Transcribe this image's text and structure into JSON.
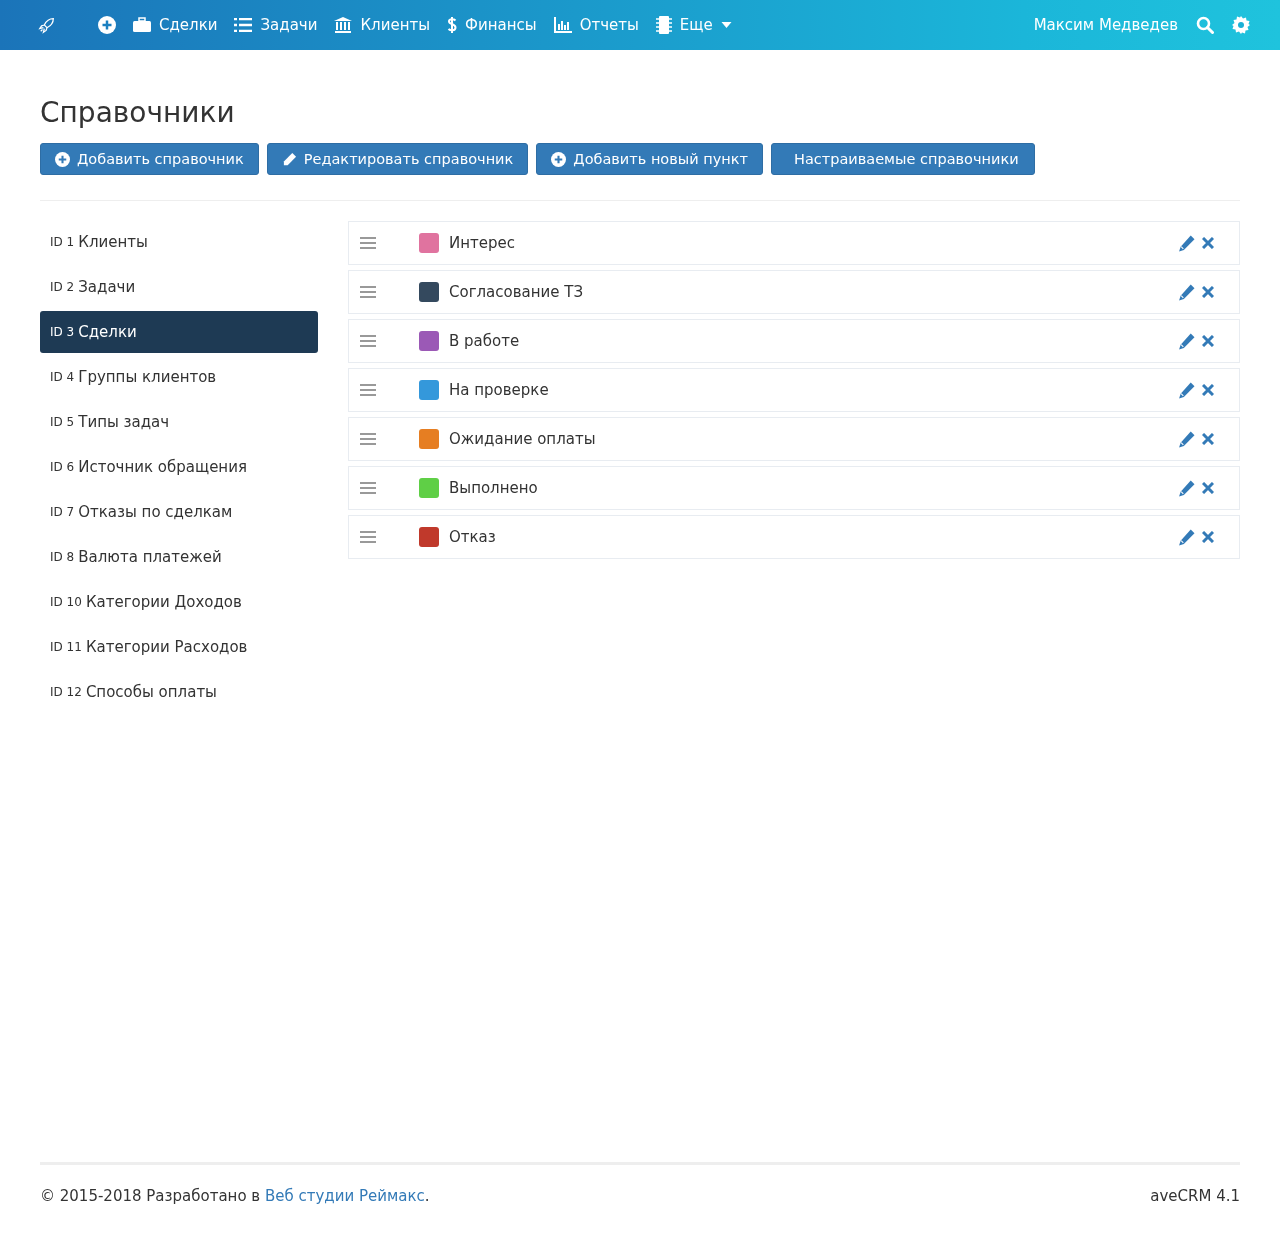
{
  "navbar": {
    "items": [
      {
        "kind": "add"
      },
      {
        "kind": "deals",
        "label": "Сделки"
      },
      {
        "kind": "tasks",
        "label": "Задачи"
      },
      {
        "kind": "clients",
        "label": "Клиенты"
      },
      {
        "kind": "finance",
        "label": "Финансы"
      },
      {
        "kind": "reports",
        "label": "Отчеты"
      },
      {
        "kind": "more",
        "label": "Еще"
      }
    ],
    "user": "Максим Медведев"
  },
  "page_title": "Справочники",
  "buttons": [
    {
      "kind": "add",
      "label": "Добавить справочник"
    },
    {
      "kind": "edit",
      "label": "Редактировать справочник"
    },
    {
      "kind": "add",
      "label": "Добавить новый пункт"
    },
    {
      "kind": "plain",
      "label": "Настраиваемые справочники"
    }
  ],
  "sidebar": {
    "items": [
      {
        "id": "ID 1",
        "name": "Клиенты",
        "selected": false
      },
      {
        "id": "ID 2",
        "name": "Задачи",
        "selected": false
      },
      {
        "id": "ID 3",
        "name": "Сделки",
        "selected": true
      },
      {
        "id": "ID 4",
        "name": "Группы клиентов",
        "selected": false
      },
      {
        "id": "ID 5",
        "name": "Типы задач",
        "selected": false
      },
      {
        "id": "ID 6",
        "name": "Источник обращения",
        "selected": false
      },
      {
        "id": "ID 7",
        "name": "Отказы по сделкам",
        "selected": false
      },
      {
        "id": "ID 8",
        "name": "Валюта платежей",
        "selected": false
      },
      {
        "id": "ID 10",
        "name": "Категории Доходов",
        "selected": false
      },
      {
        "id": "ID 11",
        "name": "Категории Расходов",
        "selected": false
      },
      {
        "id": "ID 12",
        "name": "Способы оплаты",
        "selected": false
      }
    ]
  },
  "entries": [
    {
      "name": "Интерес",
      "color": "#e0739f"
    },
    {
      "name": "Согласование ТЗ",
      "color": "#34495e"
    },
    {
      "name": "В работе",
      "color": "#9b59b6"
    },
    {
      "name": "На проверке",
      "color": "#3498db"
    },
    {
      "name": "Ожидание оплаты",
      "color": "#e67e22"
    },
    {
      "name": "Выполнено",
      "color": "#5fcf46"
    },
    {
      "name": "Отказ",
      "color": "#c0392b"
    }
  ],
  "footer": {
    "text_before": "© 2015-2018 Разработано в ",
    "link": "Веб студии Реймакс",
    "text_after": ".",
    "version": "aveCRM 4.1"
  }
}
